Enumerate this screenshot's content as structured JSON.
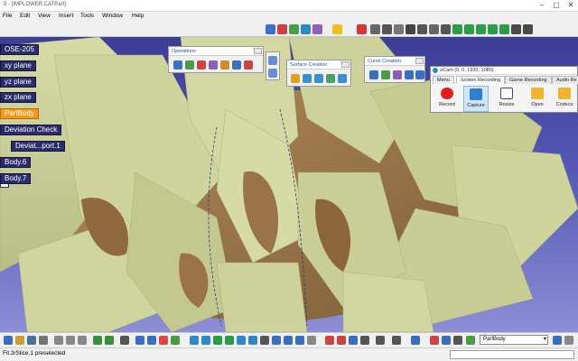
{
  "window": {
    "title": "5 - [IMPLOWER.CATPart]"
  },
  "menu": {
    "items": [
      "File",
      "Edit",
      "View",
      "Insert",
      "Tools",
      "Window",
      "Help"
    ]
  },
  "tree": {
    "root": "OSE-205",
    "items": [
      {
        "label": "xy plane"
      },
      {
        "label": "yz plane"
      },
      {
        "label": "zx plane"
      },
      {
        "label": "PartBody",
        "selected": true
      },
      {
        "label": "Deviation Check"
      },
      {
        "label": "Deviat...port.1"
      },
      {
        "label": "Body.6"
      },
      {
        "label": "Body.7"
      }
    ],
    "selected_color": "#f39a1c",
    "item_color": "#2b2c6a"
  },
  "toolbars": {
    "operations": {
      "title": "Operations"
    },
    "surface_creation": {
      "title": "Surface Creation"
    },
    "curve_creation": {
      "title": "Curve Creation"
    }
  },
  "ocam": {
    "title": "oCam (0, 0, 1920, 1080)",
    "tabs": [
      "Menu",
      "Screen Recording",
      "Game Recording",
      "Audio Re"
    ],
    "active_tab": "Screen Recording",
    "buttons": [
      {
        "label": "Record",
        "icon": "record-icon",
        "color": "#e02020"
      },
      {
        "label": "Capture",
        "icon": "monitor-icon",
        "color": "#2f7fd0",
        "active": true
      },
      {
        "label": "Resize",
        "icon": "resize-icon",
        "color": "#4a4a4a"
      },
      {
        "label": "Open",
        "icon": "folder-icon",
        "color": "#f2b233"
      },
      {
        "label": "Codecs",
        "icon": "codecs-icon",
        "color": "#f2b233"
      }
    ]
  },
  "bottom_toolbar": {
    "current_body": "PartBody"
  },
  "status": {
    "text": "Fit.3/Slice.1 preselected"
  },
  "colors": {
    "background_top": "#3b3d96",
    "background_bottom": "#8c8ed6",
    "surface": "#c9cf97",
    "surface_dark": "#9c7a4e"
  }
}
